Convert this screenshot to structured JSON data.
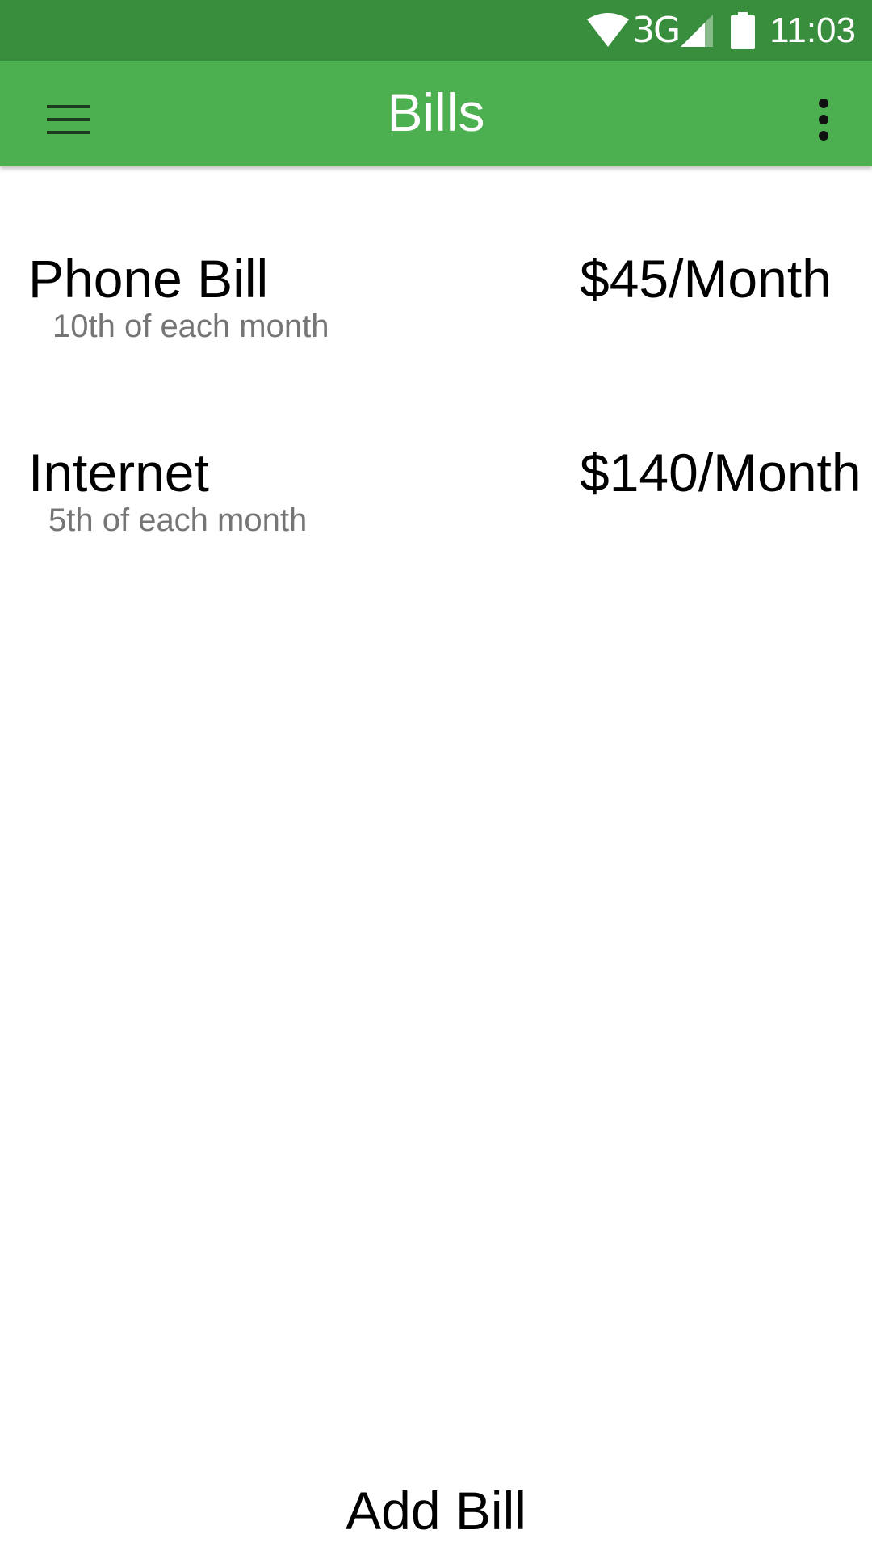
{
  "status_bar": {
    "network_label": "3G",
    "time": "11:03",
    "icons": [
      "wifi-icon",
      "cell-signal-icon",
      "battery-icon"
    ]
  },
  "app_bar": {
    "title": "Bills",
    "menu_icon": "hamburger-menu-icon",
    "overflow_icon": "more-vert-icon"
  },
  "bills": [
    {
      "name": "Phone Bill",
      "amount": "$45/Month",
      "due": "10th of each month"
    },
    {
      "name": "Internet",
      "amount": "$140/Month",
      "due": "5th of each month"
    }
  ],
  "footer": {
    "add_label": "Add Bill"
  },
  "colors": {
    "status_bar": "#388e3c",
    "app_bar": "#4caf50",
    "secondary_text": "#757575"
  }
}
